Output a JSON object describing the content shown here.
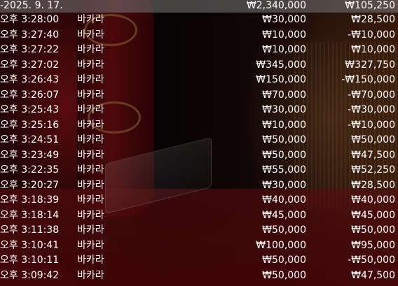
{
  "summary": {
    "date": "-2025. 9. 17.",
    "total_bet": "₩2,340,000",
    "total_result": "₩105,250"
  },
  "rows": [
    {
      "time": "오후 3:28:00",
      "game": "바카라",
      "bet": "₩30,000",
      "result": "₩28,500"
    },
    {
      "time": "오후 3:27:40",
      "game": "바카라",
      "bet": "₩10,000",
      "result": "-₩10,000"
    },
    {
      "time": "오후 3:27:22",
      "game": "바카라",
      "bet": "₩10,000",
      "result": "₩10,000"
    },
    {
      "time": "오후 3:27:02",
      "game": "바카라",
      "bet": "₩345,000",
      "result": "₩327,750"
    },
    {
      "time": "오후 3:26:43",
      "game": "바카라",
      "bet": "₩150,000",
      "result": "-₩150,000"
    },
    {
      "time": "오후 3:26:07",
      "game": "바카라",
      "bet": "₩70,000",
      "result": "-₩70,000"
    },
    {
      "time": "오후 3:25:43",
      "game": "바카라",
      "bet": "₩30,000",
      "result": "-₩30,000"
    },
    {
      "time": "오후 3:25:16",
      "game": "바카라",
      "bet": "₩10,000",
      "result": "-₩10,000"
    },
    {
      "time": "오후 3:24:51",
      "game": "바카라",
      "bet": "₩50,000",
      "result": "₩50,000"
    },
    {
      "time": "오후 3:23:49",
      "game": "바카라",
      "bet": "₩50,000",
      "result": "₩47,500"
    },
    {
      "time": "오후 3:22:35",
      "game": "바카라",
      "bet": "₩55,000",
      "result": "₩52,250"
    },
    {
      "time": "오후 3:20:27",
      "game": "바카라",
      "bet": "₩30,000",
      "result": "₩28,500"
    },
    {
      "time": "오후 3:18:39",
      "game": "바카라",
      "bet": "₩40,000",
      "result": "₩40,000"
    },
    {
      "time": "오후 3:18:14",
      "game": "바카라",
      "bet": "₩45,000",
      "result": "₩45,000"
    },
    {
      "time": "오후 3:11:38",
      "game": "바카라",
      "bet": "₩50,000",
      "result": "₩50,000"
    },
    {
      "time": "오후 3:10:41",
      "game": "바카라",
      "bet": "₩100,000",
      "result": "₩95,000"
    },
    {
      "time": "오후 3:10:11",
      "game": "바카라",
      "bet": "₩50,000",
      "result": "-₩50,000"
    },
    {
      "time": "오후 3:09:42",
      "game": "바카라",
      "bet": "₩50,000",
      "result": "₩47,500"
    }
  ]
}
